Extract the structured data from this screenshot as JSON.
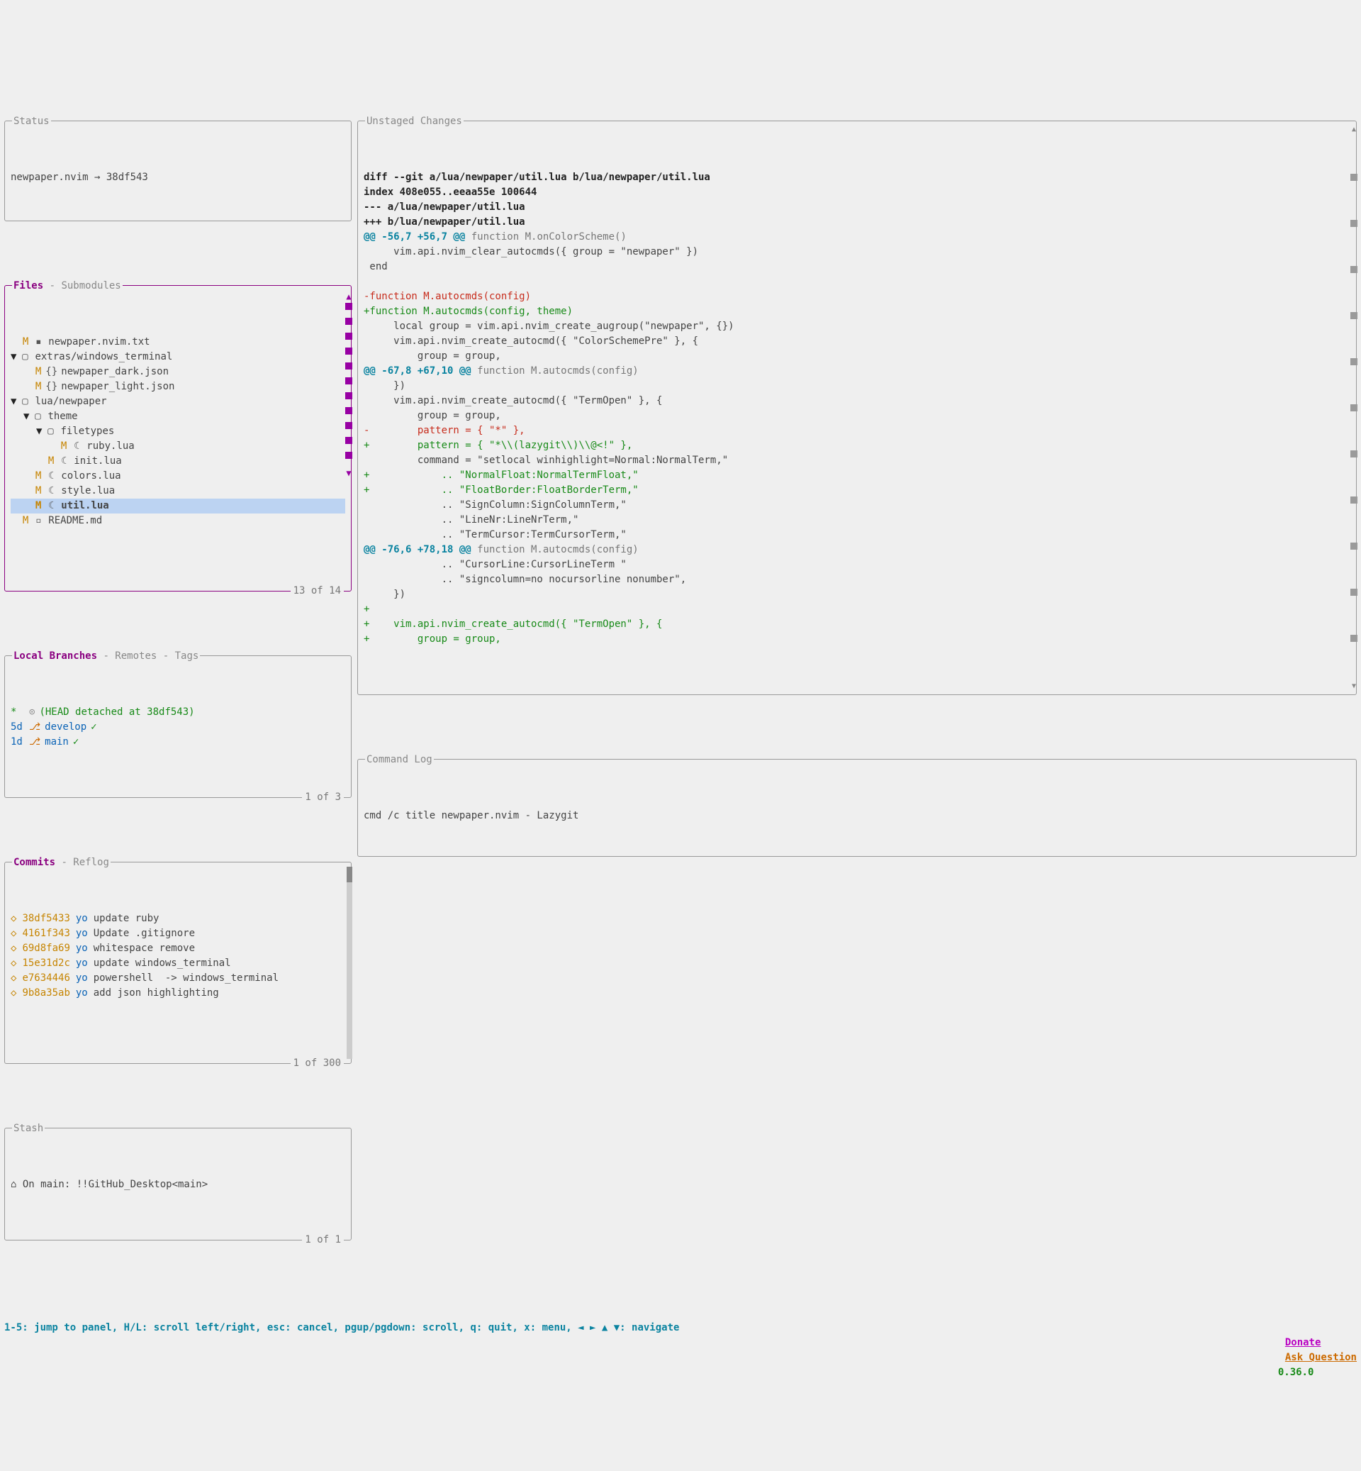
{
  "status": {
    "title": "Status",
    "text": "newpaper.nvim → 38df543"
  },
  "files": {
    "title_main": "Files",
    "title_rest": " - Submodules",
    "counter": "13 of 14",
    "items": [
      {
        "indent": 0,
        "arrow": " ",
        "status": "M",
        "icon": "file",
        "name": "newpaper.nvim.txt"
      },
      {
        "indent": 0,
        "arrow": "▼",
        "status": " ",
        "icon": "folder",
        "name": "extras/windows_terminal"
      },
      {
        "indent": 1,
        "arrow": " ",
        "status": "M",
        "icon": "braces",
        "name": "newpaper_dark.json"
      },
      {
        "indent": 1,
        "arrow": " ",
        "status": "M",
        "icon": "braces",
        "name": "newpaper_light.json"
      },
      {
        "indent": 0,
        "arrow": "▼",
        "status": " ",
        "icon": "folder",
        "name": "lua/newpaper"
      },
      {
        "indent": 1,
        "arrow": "▼",
        "status": " ",
        "icon": "folder",
        "name": "theme"
      },
      {
        "indent": 2,
        "arrow": "▼",
        "status": " ",
        "icon": "folder",
        "name": "filetypes"
      },
      {
        "indent": 3,
        "arrow": " ",
        "status": "M",
        "icon": "lua",
        "name": "ruby.lua"
      },
      {
        "indent": 2,
        "arrow": " ",
        "status": "M",
        "icon": "lua",
        "name": "init.lua"
      },
      {
        "indent": 1,
        "arrow": " ",
        "status": "M",
        "icon": "lua",
        "name": "colors.lua"
      },
      {
        "indent": 1,
        "arrow": " ",
        "status": "M",
        "icon": "lua",
        "name": "style.lua"
      },
      {
        "indent": 1,
        "arrow": " ",
        "status": "M",
        "icon": "lua",
        "name": "util.lua",
        "selected": true
      },
      {
        "indent": 0,
        "arrow": " ",
        "status": "M",
        "icon": "md",
        "name": "README.md"
      }
    ]
  },
  "branches": {
    "title_main": "Local Branches",
    "title_rest": " - Remotes - Tags",
    "counter": "1 of 3",
    "items": [
      {
        "mark": "*",
        "icon": "commit",
        "label": "(HEAD detached at 38df543)",
        "color": "green",
        "check": ""
      },
      {
        "mark": "5d",
        "icon": "branch",
        "label": "develop",
        "color": "blue",
        "check": "✓"
      },
      {
        "mark": "1d",
        "icon": "branch",
        "label": "main",
        "color": "blue",
        "check": "✓"
      }
    ]
  },
  "commits": {
    "title_main": "Commits",
    "title_rest": " - Reflog",
    "counter": "1 of 300",
    "items": [
      {
        "hash": "38df5433",
        "author": "yo",
        "msg": "update ruby"
      },
      {
        "hash": "4161f343",
        "author": "yo",
        "msg": "Update .gitignore"
      },
      {
        "hash": "69d8fa69",
        "author": "yo",
        "msg": "whitespace remove"
      },
      {
        "hash": "15e31d2c",
        "author": "yo",
        "msg": "update windows_terminal"
      },
      {
        "hash": "e7634446",
        "author": "yo",
        "msg": "powershell  -> windows_terminal"
      },
      {
        "hash": "9b8a35ab",
        "author": "yo",
        "msg": "add json highlighting"
      }
    ]
  },
  "stash": {
    "title": "Stash",
    "counter": "1 of 1",
    "text": "On main: !!GitHub_Desktop<main>"
  },
  "diff": {
    "title": "Unstaged Changes",
    "lines": [
      {
        "t": "head",
        "s": "diff --git a/lua/newpaper/util.lua b/lua/newpaper/util.lua"
      },
      {
        "t": "head",
        "s": "index 408e055..eeaa55e 100644"
      },
      {
        "t": "head",
        "s": "--- a/lua/newpaper/util.lua"
      },
      {
        "t": "head",
        "s": "+++ b/lua/newpaper/util.lua"
      },
      {
        "t": "hunk",
        "s": "@@ -56,7 +56,7 @@",
        "ctx": " function M.onColorScheme()"
      },
      {
        "t": "ctx",
        "s": "     vim.api.nvim_clear_autocmds({ group = \"newpaper\" })"
      },
      {
        "t": "ctx",
        "s": " end"
      },
      {
        "t": "ctx",
        "s": ""
      },
      {
        "t": "del",
        "s": "-function M.autocmds(config)"
      },
      {
        "t": "add",
        "s": "+function M.autocmds(config, theme)"
      },
      {
        "t": "ctx",
        "s": "     local group = vim.api.nvim_create_augroup(\"newpaper\", {})"
      },
      {
        "t": "ctx",
        "s": "     vim.api.nvim_create_autocmd({ \"ColorSchemePre\" }, {"
      },
      {
        "t": "ctx",
        "s": "         group = group,"
      },
      {
        "t": "hunk",
        "s": "@@ -67,8 +67,10 @@",
        "ctx": " function M.autocmds(config)"
      },
      {
        "t": "ctx",
        "s": "     })"
      },
      {
        "t": "ctx",
        "s": "     vim.api.nvim_create_autocmd({ \"TermOpen\" }, {"
      },
      {
        "t": "ctx",
        "s": "         group = group,"
      },
      {
        "t": "del",
        "s": "-        pattern = { \"*\" },"
      },
      {
        "t": "add",
        "s": "+        pattern = { \"*\\\\(lazygit\\\\)\\\\@<!\" },"
      },
      {
        "t": "ctx",
        "s": "         command = \"setlocal winhighlight=Normal:NormalTerm,\""
      },
      {
        "t": "add",
        "s": "+            .. \"NormalFloat:NormalTermFloat,\""
      },
      {
        "t": "add",
        "s": "+            .. \"FloatBorder:FloatBorderTerm,\""
      },
      {
        "t": "ctx",
        "s": "             .. \"SignColumn:SignColumnTerm,\""
      },
      {
        "t": "ctx",
        "s": "             .. \"LineNr:LineNrTerm,\""
      },
      {
        "t": "ctx",
        "s": "             .. \"TermCursor:TermCursorTerm,\""
      },
      {
        "t": "hunk",
        "s": "@@ -76,6 +78,18 @@",
        "ctx": " function M.autocmds(config)"
      },
      {
        "t": "ctx",
        "s": "             .. \"CursorLine:CursorLineTerm \""
      },
      {
        "t": "ctx",
        "s": "             .. \"signcolumn=no nocursorline nonumber\","
      },
      {
        "t": "ctx",
        "s": "     })"
      },
      {
        "t": "add",
        "s": "+"
      },
      {
        "t": "add",
        "s": "+    vim.api.nvim_create_autocmd({ \"TermOpen\" }, {"
      },
      {
        "t": "add",
        "s": "+        group = group,"
      }
    ]
  },
  "cmdlog": {
    "title": "Command Log",
    "text": "cmd /c title newpaper.nvim - Lazygit"
  },
  "help": {
    "text": "1-5: jump to panel, H/L: scroll left/right, esc: cancel, pgup/pgdown: scroll, q: quit, x: menu, ◄ ► ▲ ▼: navigate",
    "donate": "Donate",
    "ask": "Ask Question",
    "version": "0.36.0"
  }
}
